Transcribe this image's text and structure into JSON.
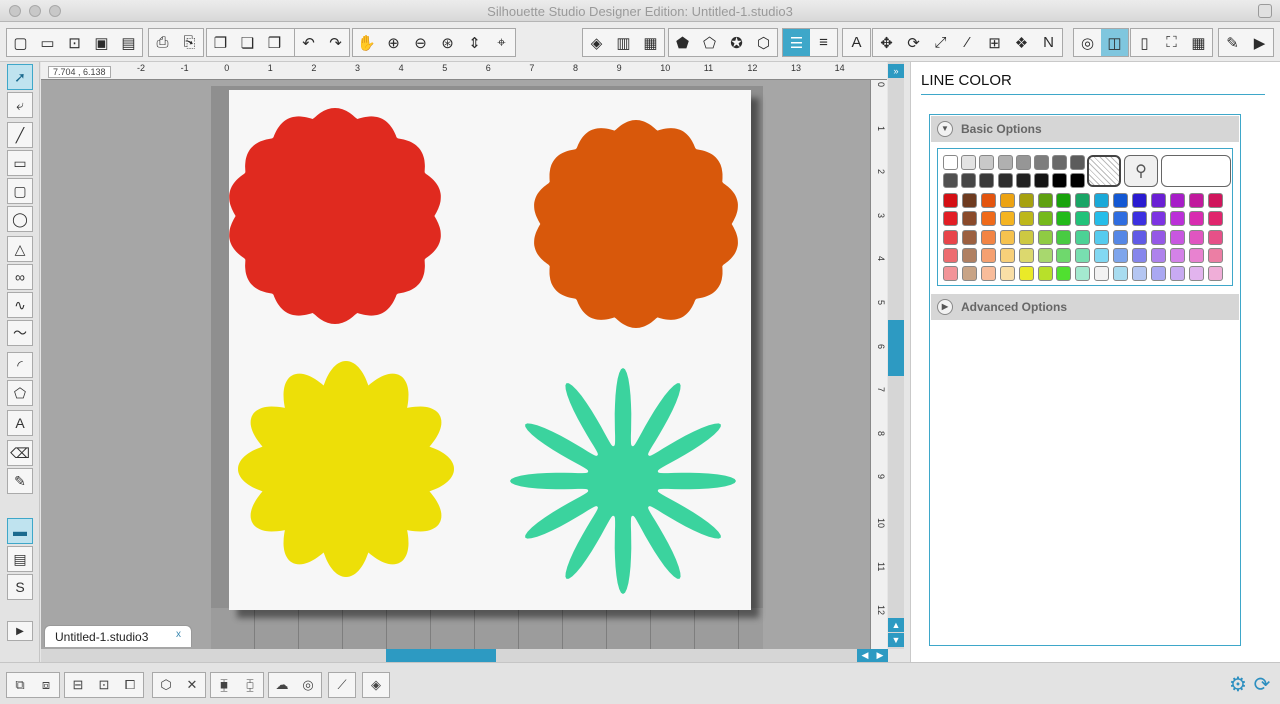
{
  "window": {
    "title": "Silhouette Studio Designer Edition: Untitled-1.studio3"
  },
  "toolbar": {
    "groups": [
      [
        "new-doc-icon",
        "open-folder-icon",
        "new-page-icon",
        "save-icon",
        "save-to-library-icon"
      ],
      [
        "print-icon",
        "print-cut-icon"
      ],
      [
        "copy-icon",
        "paste-icon",
        "paste-in-front-icon",
        "cut-icon"
      ],
      [
        "undo-icon",
        "redo-icon"
      ],
      [
        "pan-icon",
        "zoom-in-icon",
        "zoom-out-icon",
        "zoom-box-icon",
        "drag-zoom-icon",
        "fit-page-icon"
      ],
      [
        "fill-color-icon",
        "gradient-icon",
        "fill-pattern-icon"
      ],
      [
        "line-color-icon",
        "line-gradient-icon",
        "line-style-icon",
        "line-pattern-icon"
      ],
      [
        "line-weight-icon",
        "line-type-icon"
      ],
      [
        "text-style-icon"
      ],
      [
        "transform-icon",
        "rotate-icon",
        "scale-icon",
        "shear-icon",
        "align-icon",
        "replicate-icon",
        "nest-icon"
      ],
      [
        "offset-icon",
        "trace-icon"
      ],
      [
        "page-setup-icon",
        "registration-icon",
        "grid-icon"
      ],
      [
        "cut-settings-icon",
        "send-to-silhouette-icon"
      ]
    ]
  },
  "toolbar_symbols": {
    "new-doc-icon": "▢",
    "open-folder-icon": "▭",
    "new-page-icon": "⊡",
    "save-icon": "▣",
    "save-to-library-icon": "▤",
    "print-icon": "⎙",
    "print-cut-icon": "⎘",
    "copy-icon": "❐",
    "paste-icon": "❏",
    "paste-in-front-icon": "❒",
    "cut-icon": "✂",
    "undo-icon": "↶",
    "redo-icon": "↷",
    "pan-icon": "✋",
    "zoom-in-icon": "⊕",
    "zoom-out-icon": "⊖",
    "zoom-box-icon": "⊛",
    "drag-zoom-icon": "⇕",
    "fit-page-icon": "⌖",
    "fill-color-icon": "◈",
    "gradient-icon": "▥",
    "fill-pattern-icon": "▦",
    "line-color-icon": "⬟",
    "line-gradient-icon": "⬠",
    "line-style-icon": "✪",
    "line-pattern-icon": "⬡",
    "line-weight-icon": "☰",
    "line-type-icon": "≡",
    "text-style-icon": "A",
    "transform-icon": "✥",
    "rotate-icon": "⟳",
    "scale-icon": "⤢",
    "shear-icon": "⁄",
    "align-icon": "⊞",
    "replicate-icon": "❖",
    "nest-icon": "N",
    "offset-icon": "◎",
    "trace-icon": "◫",
    "page-setup-icon": "▯",
    "registration-icon": "⛶",
    "grid-icon": "▦",
    "cut-settings-icon": "✎",
    "send-to-silhouette-icon": "▶"
  },
  "active_toolbar_icons": [
    "line-weight-icon",
    "trace-icon"
  ],
  "left_tools": [
    {
      "name": "select-tool-icon",
      "sym": "➚"
    },
    {
      "name": "point-edit-tool-icon",
      "sym": "⤶"
    },
    {
      "name": "line-tool-icon",
      "sym": "╱"
    },
    {
      "name": "rectangle-tool-icon",
      "sym": "▭"
    },
    {
      "name": "rounded-rect-tool-icon",
      "sym": "▢"
    },
    {
      "name": "ellipse-tool-icon",
      "sym": "◯"
    },
    {
      "name": "polygon-tool-icon",
      "sym": "△"
    },
    {
      "name": "curve-tool-icon",
      "sym": "∞"
    },
    {
      "name": "freehand-tool-icon",
      "sym": "∿"
    },
    {
      "name": "smooth-freehand-tool-icon",
      "sym": "〜"
    },
    {
      "name": "arc-tool-icon",
      "sym": "◜"
    },
    {
      "name": "regular-polygon-tool-icon",
      "sym": "⬠"
    },
    {
      "name": "text-tool-icon",
      "sym": "A"
    },
    {
      "name": "eraser-tool-icon",
      "sym": "⌫"
    },
    {
      "name": "knife-tool-icon",
      "sym": "✎"
    },
    {
      "name": "design-area-icon",
      "sym": "▬"
    },
    {
      "name": "library-icon",
      "sym": "▤"
    },
    {
      "name": "online-store-icon",
      "sym": "S"
    }
  ],
  "ruler": {
    "coords": "7.704 , 6.138",
    "h_ticks": [
      "-2",
      "-1",
      "0",
      "1",
      "2",
      "3",
      "4",
      "5",
      "6",
      "7",
      "8",
      "9",
      "10",
      "11",
      "12",
      "13",
      "14"
    ],
    "v_ticks": [
      "0",
      "1",
      "2",
      "3",
      "4",
      "5",
      "6",
      "7",
      "8",
      "9",
      "10",
      "11",
      "12"
    ]
  },
  "shapes": [
    {
      "name": "red-scallop-shape",
      "color": "#e02a1f",
      "kind": "scallop",
      "lobes": 14
    },
    {
      "name": "orange-scallop-shape",
      "color": "#d8580b",
      "kind": "scallop",
      "lobes": 14
    },
    {
      "name": "yellow-flower-shape",
      "color": "#eddf08",
      "kind": "flower",
      "lobes": 12
    },
    {
      "name": "green-star-shape",
      "color": "#3bd39e",
      "kind": "star",
      "lobes": 12
    }
  ],
  "document_tab": {
    "label": "Untitled-1.studio3",
    "close": "x"
  },
  "panel": {
    "title": "LINE COLOR",
    "basic_options": "Basic Options",
    "advanced_options": "Advanced Options",
    "gray_row1": [
      "#ffffff",
      "#e3e3e3",
      "#c9c9c9",
      "#b0b0b0",
      "#969696",
      "#7d7d7d",
      "#6a6a6a",
      "#5c5c5c"
    ],
    "gray_row2": [
      "#505050",
      "#464646",
      "#3a3a3a",
      "#2e2e2e",
      "#222222",
      "#141414",
      "#000000",
      "#000000"
    ],
    "color_rows": [
      [
        "#d40f14",
        "#6e3b20",
        "#e3540e",
        "#eca313",
        "#a6a10f",
        "#5fa111",
        "#19a30c",
        "#1aa566",
        "#1aa9d8",
        "#1358d3",
        "#2a1bd0",
        "#6a1fd4",
        "#a71ec8",
        "#c1199d",
        "#d0155c"
      ],
      [
        "#e21d24",
        "#8a4a2a",
        "#ef6a1a",
        "#f4b421",
        "#bdb71a",
        "#75b91b",
        "#23ba1a",
        "#22c27a",
        "#25bde9",
        "#2f6de0",
        "#3c30e0",
        "#7d33e2",
        "#bb30d8",
        "#d82cb0",
        "#e0256d"
      ],
      [
        "#e8444a",
        "#9c6040",
        "#f28444",
        "#f6c24e",
        "#cdc842",
        "#8fcb43",
        "#48cb42",
        "#4cd295",
        "#55cbee",
        "#5587e6",
        "#605ae6",
        "#9558e6",
        "#c857e0",
        "#e055c0",
        "#e65088"
      ],
      [
        "#ed6c70",
        "#b08062",
        "#f5a070",
        "#f8d07a",
        "#dcd86e",
        "#a8d86e",
        "#6fd86d",
        "#78dfb0",
        "#82d8f2",
        "#7ea5ec",
        "#8686ec",
        "#ae82ec",
        "#d482e8",
        "#e882d0",
        "#ec7ea4"
      ],
      [
        "#f29498",
        "#c8a486",
        "#f8bc9a",
        "#fadfa6",
        "#eaea28",
        "#b8e02a",
        "#50e030",
        "#a4ead0",
        "#f2f2f2",
        "#a8dcf0",
        "#b4c6f2",
        "#aaa8f2",
        "#c8aaf2",
        "#e2b4ee",
        "#f0aed8"
      ]
    ]
  },
  "bottom_tools": [
    [
      "group-icon",
      "ungroup-icon"
    ],
    [
      "make-compound-icon",
      "release-compound-icon",
      "bring-forward-icon"
    ],
    [
      "weld-icon",
      "delete-icon"
    ],
    [
      "send-backward-icon",
      "send-back-icon"
    ],
    [
      "cloud-icon",
      "spiral-icon"
    ],
    [
      "knife-bottom-icon"
    ],
    [
      "3d-icon"
    ]
  ],
  "bottom_symbols": {
    "group-icon": "⧉",
    "ungroup-icon": "⧈",
    "make-compound-icon": "⊟",
    "release-compound-icon": "⊡",
    "bring-forward-icon": "⧠",
    "weld-icon": "⬡",
    "delete-icon": "✕",
    "send-backward-icon": "⧯",
    "send-back-icon": "⧮",
    "cloud-icon": "☁",
    "spiral-icon": "◎",
    "knife-bottom-icon": "⟋",
    "3d-icon": "◈"
  }
}
